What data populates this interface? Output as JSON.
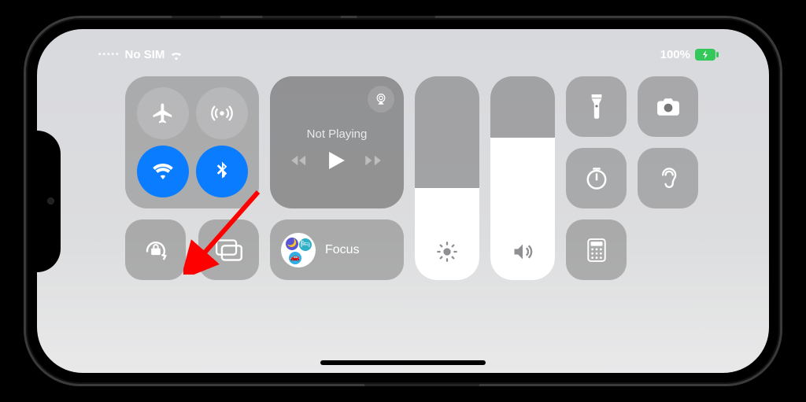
{
  "status": {
    "carrier": "No SIM",
    "battery_text": "100%"
  },
  "media": {
    "title": "Not Playing"
  },
  "sliders": {
    "brightness_percent": 45,
    "volume_percent": 70
  },
  "focus": {
    "label": "Focus"
  },
  "tiles": {
    "airplane": "airplane-mode",
    "cellular": "cellular-data",
    "wifi": "wifi",
    "bluetooth": "bluetooth",
    "orientation_lock": "orientation-lock",
    "screen_mirror": "screen-mirroring",
    "flashlight": "flashlight",
    "camera": "camera",
    "timer": "timer",
    "hearing": "hearing",
    "calculator": "calculator"
  },
  "colors": {
    "active_blue": "#0a7cff",
    "battery_green": "#34c759",
    "arrow_red": "#ff0000"
  }
}
